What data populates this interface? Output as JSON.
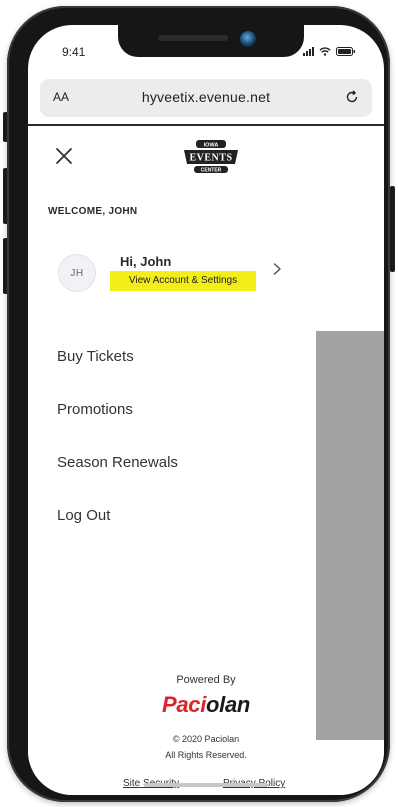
{
  "status_bar": {
    "time": "9:41"
  },
  "browser": {
    "text_size_label": "AA",
    "url": "hyveetix.evenue.net",
    "reload_icon": "reload-icon"
  },
  "logo": {
    "line1": "IOWA",
    "line2": "EVENTS",
    "line3": "CENTER"
  },
  "menu": {
    "welcome": "WELCOME, JOHN",
    "account": {
      "initials": "JH",
      "greeting": "Hi, John",
      "link_label": "View Account & Settings",
      "highlight_color": "#f3ee1a"
    },
    "items": [
      {
        "label": "Buy Tickets"
      },
      {
        "label": "Promotions"
      },
      {
        "label": "Season Renewals"
      },
      {
        "label": "Log Out"
      }
    ]
  },
  "footer": {
    "powered_by": "Powered By",
    "brand_part1": "Paci",
    "brand_part2": "olan",
    "brand_colors": {
      "accent": "#d9252a",
      "dark": "#1a1a1a"
    },
    "copyright": "© 2020 Paciolan",
    "rights": "All Rights Reserved.",
    "links": [
      {
        "label": "Site Security"
      },
      {
        "label": "Privacy Policy"
      }
    ]
  },
  "icons": {
    "close": "close-icon",
    "chevron": "chevron-right-icon",
    "signal": "signal-icon",
    "wifi": "wifi-icon",
    "battery": "battery-icon"
  }
}
